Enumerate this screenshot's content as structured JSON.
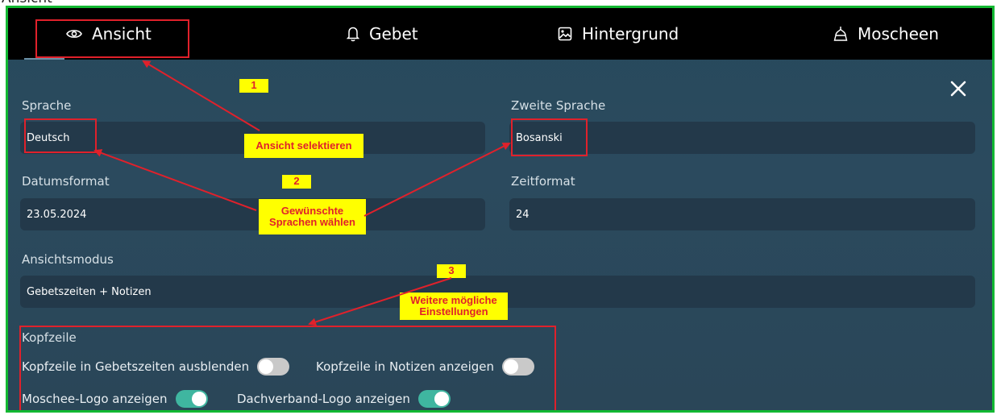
{
  "top_cropped_text": "Ansicht",
  "tabs": [
    {
      "label": "Ansicht",
      "icon": "eye-icon",
      "selected": true
    },
    {
      "label": "Gebet",
      "icon": "bell-icon",
      "selected": false
    },
    {
      "label": "Hintergrund",
      "icon": "image-icon",
      "selected": false
    },
    {
      "label": "Moscheen",
      "icon": "mosque-icon",
      "selected": false
    }
  ],
  "settings": {
    "language_label": "Sprache",
    "language_value": "Deutsch",
    "second_language_label": "Zweite Sprache",
    "second_language_value": "Bosanski",
    "date_format_label": "Datumsformat",
    "date_format_value": "23.05.2024",
    "time_format_label": "Zeitformat",
    "time_format_value": "24",
    "view_mode_label": "Ansichtsmodus",
    "view_mode_value": "Gebetszeiten + Notizen"
  },
  "header_section": {
    "title": "Kopfzeile",
    "toggles": [
      {
        "label": "Kopfzeile in Gebetszeiten ausblenden",
        "on": false
      },
      {
        "label": "Kopfzeile in Notizen anzeigen",
        "on": false
      },
      {
        "label": "Moschee-Logo anzeigen",
        "on": true
      },
      {
        "label": "Dachverband-Logo anzeigen",
        "on": true
      }
    ]
  },
  "annotations": {
    "badge_1": "1",
    "badge_2": "2",
    "badge_3": "3",
    "callout_1": "Ansicht selektieren",
    "callout_2_line1": "Gewünschte",
    "callout_2_line2": "Sprachen wählen",
    "callout_3_line1": "Weitere mögliche",
    "callout_3_line2": "Einstellungen"
  },
  "colors": {
    "frame_border": "#12b832",
    "annotation_red": "#e0212b",
    "annotation_yellow": "#ffff00",
    "toggle_on": "#3fb6a0",
    "toggle_off": "#c9c9c9"
  }
}
